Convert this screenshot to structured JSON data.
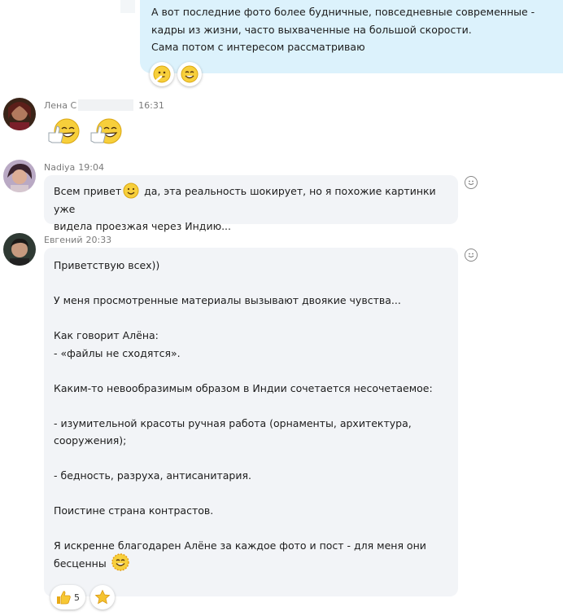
{
  "outgoing": {
    "text": "А вот последние фото более будничные, повседневные современные -\nкадры из жизни, часто выхваченные на большой скорости.\nСама потом с интересом рассматриваю"
  },
  "messages": [
    {
      "author": "Лена С",
      "time": "16:31"
    },
    {
      "author": "Nadiya",
      "time": "19:04",
      "text_before_emoji": "Всем привет",
      "text_after_emoji": " да,  эта реальность шокирует,  но я похожие картинки уже",
      "text_line2": "видела проезжая через Индию..."
    },
    {
      "author": "Евгений",
      "time": "20:33",
      "lines": [
        "Приветствую всех))",
        "",
        "У меня просмотренные материалы вызывают двоякие чувства...",
        "",
        "Как говорит Алёна:",
        "- «файлы не сходятся».",
        "",
        "Каким-то невообразимым образом в Индии сочетается несочетаемое:",
        "",
        "- изумительной красоты ручная работа (орнаменты, архитектура,",
        "сооружения);",
        "",
        "- бедность, разруха, антисанитария.",
        "",
        "Поистине страна контрастов.",
        "",
        "Я искренне благодарен Алёне за каждое фото и пост - для меня они"
      ],
      "last_line": "бесценны",
      "reactions": [
        {
          "icon": "thumbs-up-icon",
          "count": "5"
        },
        {
          "icon": "star-icon"
        }
      ]
    }
  ],
  "colors": {
    "outgoing_bubble": "#dcf2fc",
    "incoming_bubble": "#f2f4f7",
    "meta_text": "#7a7a7a"
  }
}
